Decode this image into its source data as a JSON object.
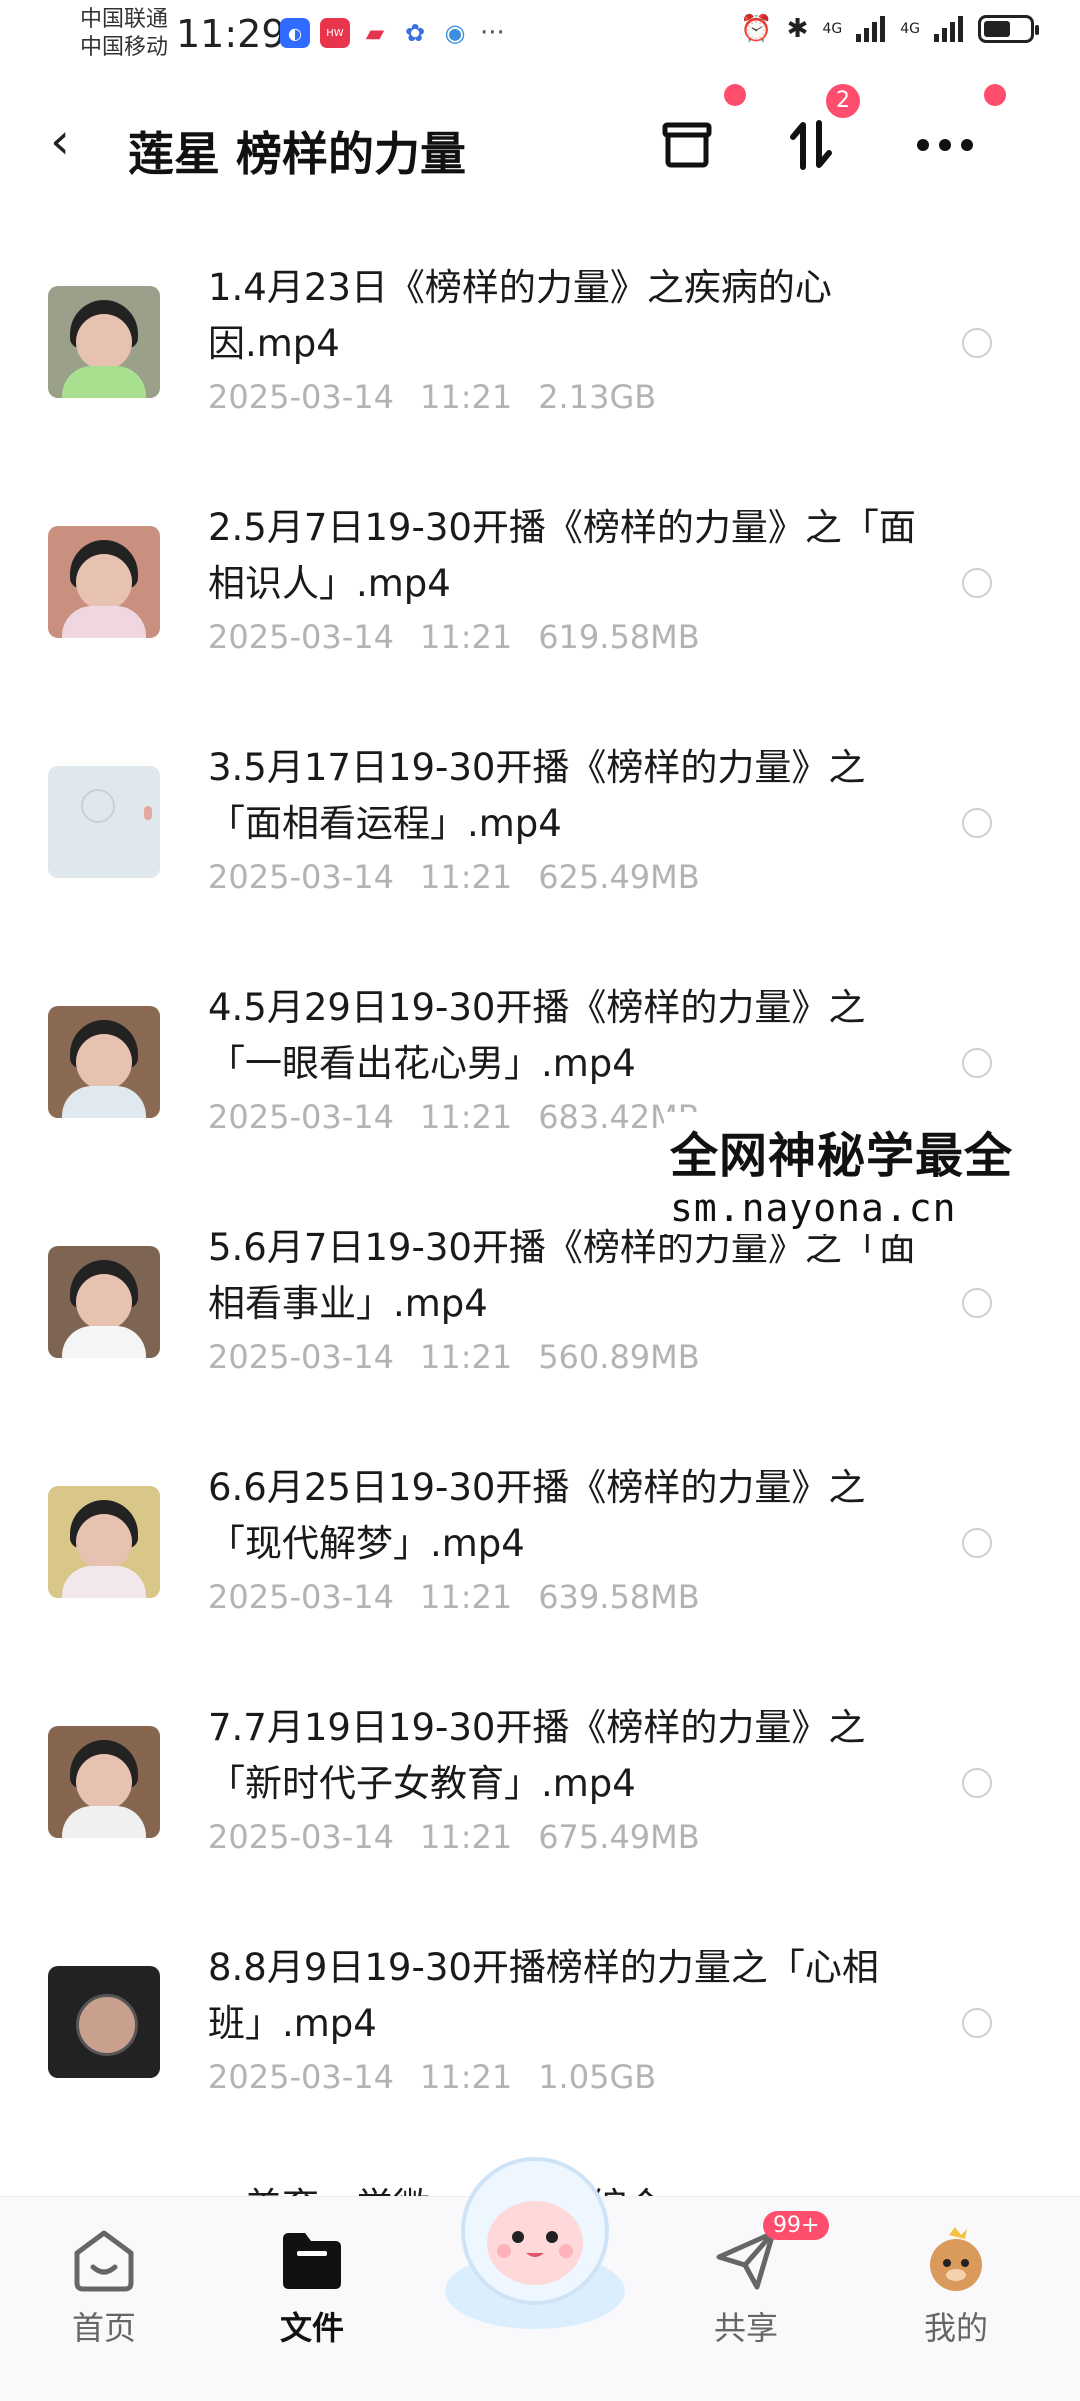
{
  "status_bar": {
    "carrier_1": "中国联通",
    "carrier_2": "中国移动",
    "time": "11:29",
    "more": "···",
    "network_1": "4G",
    "network_2": "4G",
    "battery_level": 0.6
  },
  "header": {
    "back_label": "‹",
    "title": "莲星 榜样的力量",
    "sort_badge": "2"
  },
  "files": [
    {
      "name": "1.4月23日《榜样的力量》之疾病的心因.mp4",
      "date": "2025-03-14",
      "time": "11:21",
      "size": "2.13GB"
    },
    {
      "name": "2.5月7日19-30开播《榜样的力量》之「面相识人」.mp4",
      "date": "2025-03-14",
      "time": "11:21",
      "size": "619.58MB"
    },
    {
      "name": "3.5月17日19-30开播《榜样的力量》之「面相看运程」.mp4",
      "date": "2025-03-14",
      "time": "11:21",
      "size": "625.49MB"
    },
    {
      "name": "4.5月29日19-30开播《榜样的力量》之「一眼看出花心男」.mp4",
      "date": "2025-03-14",
      "time": "11:21",
      "size": "683.42MB"
    },
    {
      "name": "5.6月7日19-30开播《榜样的力量》之「面相看事业」.mp4",
      "date": "2025-03-14",
      "time": "11:21",
      "size": "560.89MB"
    },
    {
      "name": "6.6月25日19-30开播《榜样的力量》之「现代解梦」.mp4",
      "date": "2025-03-14",
      "time": "11:21",
      "size": "639.58MB"
    },
    {
      "name": "7.7月19日19-30开播《榜样的力量》之「新时代子女教育」.mp4",
      "date": "2025-03-14",
      "time": "11:21",
      "size": "675.49MB"
    },
    {
      "name": "8.8月9日19-30开播榜样的力量之「心相班」.mp4",
      "date": "2025-03-14",
      "time": "11:21",
      "size": "1.05GB"
    }
  ],
  "watermark": {
    "line1": "全网神秘学最全",
    "line2": "sm.nayona.cn"
  },
  "partial_row": "…美育…学微…                …会院综合…",
  "bottom_nav": {
    "home": "首页",
    "files": "文件",
    "share": "共享",
    "share_badge": "99+",
    "mine": "我的"
  }
}
